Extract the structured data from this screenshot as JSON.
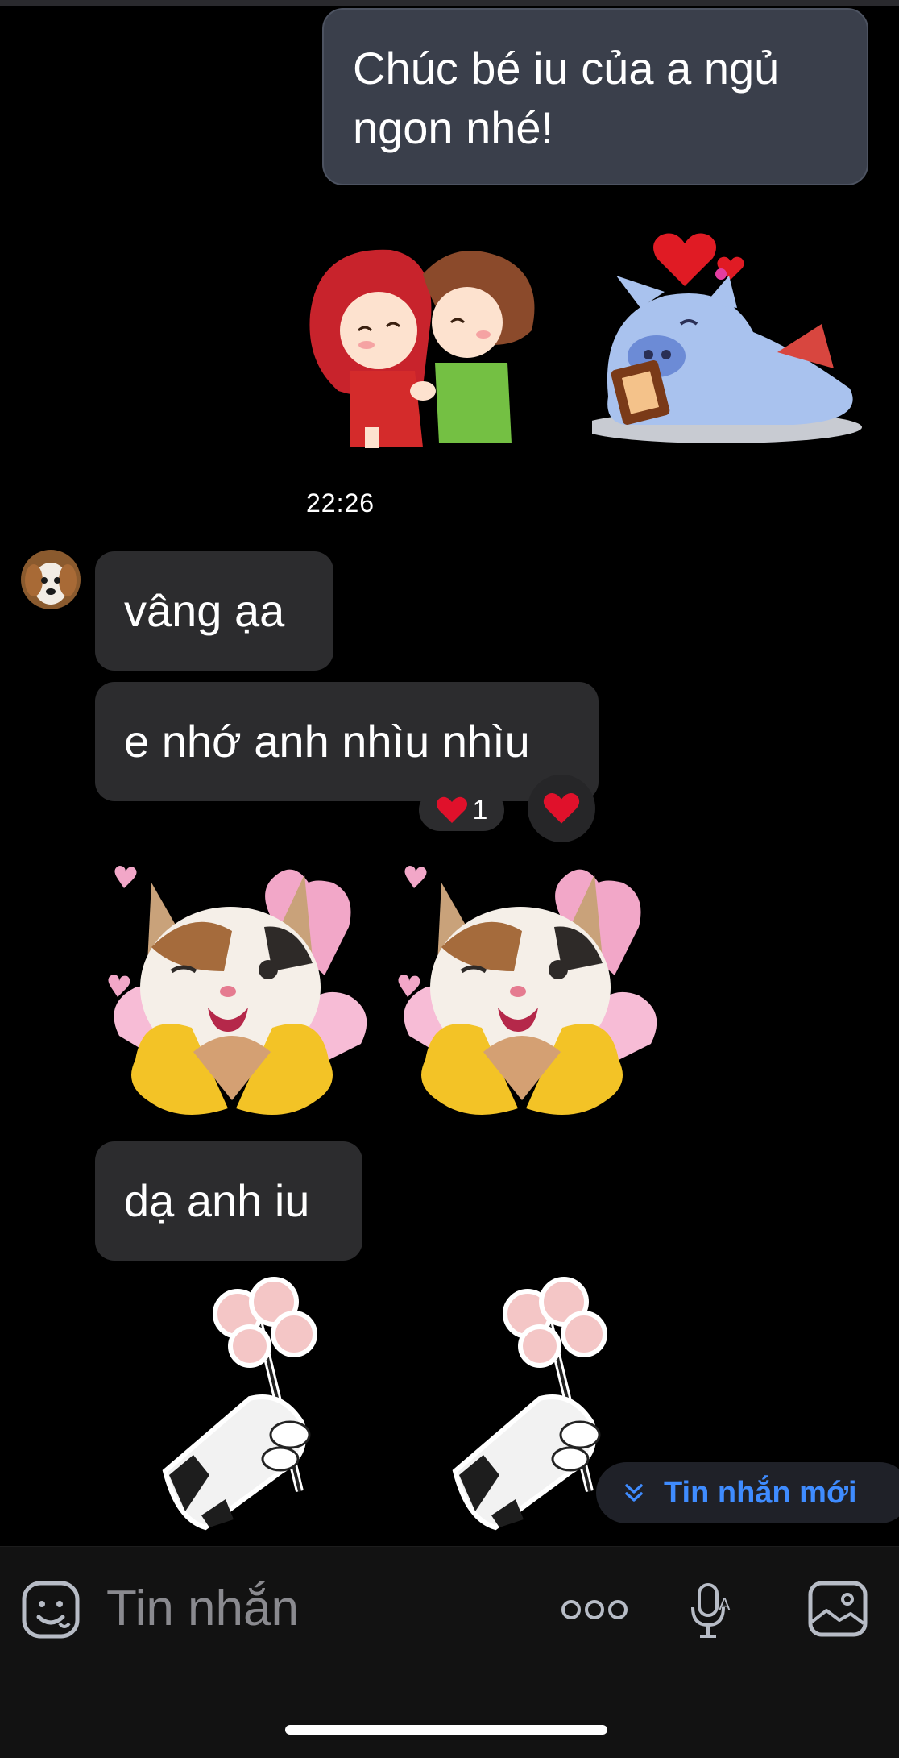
{
  "chat": {
    "outgoing_message": "Chúc bé iu của a ngủ ngon nhé!",
    "timestamp": "22:26",
    "incoming_messages": [
      {
        "text": "vâng ạa"
      },
      {
        "text": "e nhớ anh nhìu nhìu"
      },
      {
        "text": "dạ anh iu"
      }
    ],
    "reaction": {
      "emoji": "heart",
      "count": "1"
    },
    "stickers": [
      "kissing-couple-sticker",
      "sleeping-dragon-sticker",
      "winking-cat-heart-hands-sticker",
      "winking-cat-heart-hands-sticker",
      "paw-holding-flower-sticker",
      "paw-holding-flower-sticker"
    ]
  },
  "new_messages_button": {
    "label": "Tin nhắn mới",
    "icon": "double-chevron-down-icon"
  },
  "composer": {
    "placeholder": "Tin nhắn",
    "icons": [
      "sticker-smiley-icon",
      "more-dots-icon",
      "voice-to-text-icon",
      "image-gallery-icon"
    ]
  },
  "colors": {
    "background": "#000000",
    "outgoing_bubble": "#3a3f4b",
    "incoming_bubble": "#2c2c2e",
    "accent": "#3f8cff",
    "reaction": "#e0112b"
  }
}
